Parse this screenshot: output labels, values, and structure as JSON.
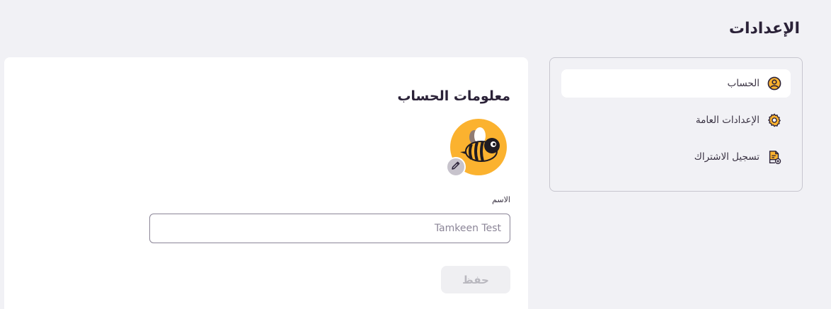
{
  "page": {
    "title": "الإعدادات"
  },
  "sidebar": {
    "items": [
      {
        "label": "الحساب",
        "icon": "user-circle-icon",
        "active": true
      },
      {
        "label": "الإعدادات العامة",
        "icon": "gear-icon",
        "active": false
      },
      {
        "label": "تسجيل الاشتراك",
        "icon": "document-add-icon",
        "active": false
      }
    ]
  },
  "account": {
    "title": "معلومات الحساب",
    "avatar_icon": "bee-avatar",
    "edit_icon": "pencil-icon",
    "name_label": "الاسم",
    "name_value": "Tamkeen Test",
    "save_label": "حفظ"
  },
  "colors": {
    "accent": "#fbb22f",
    "background": "#f1f1f5",
    "text": "#2b2238",
    "disabled": "#b9b8bf"
  }
}
